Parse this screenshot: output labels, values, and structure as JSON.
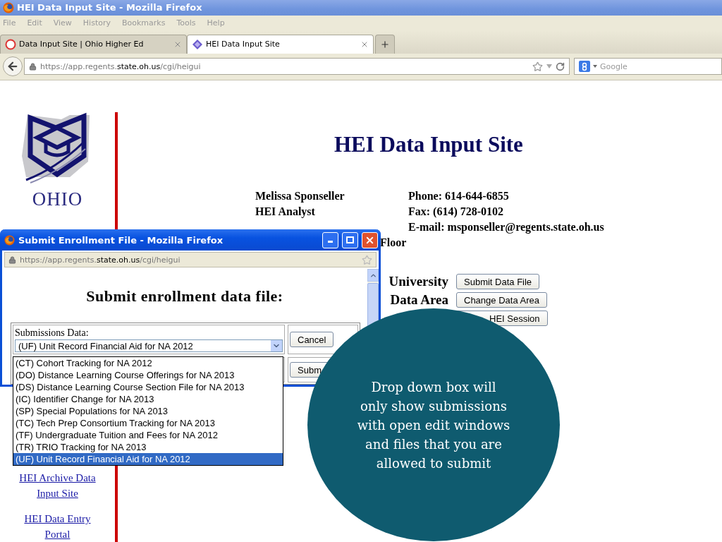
{
  "browser": {
    "title": "HEI Data Input Site - Mozilla Firefox",
    "menu": [
      "File",
      "Edit",
      "View",
      "History",
      "Bookmarks",
      "Tools",
      "Help"
    ],
    "tabs": [
      {
        "label": "Data Input Site | Ohio Higher Ed",
        "selected": false
      },
      {
        "label": "HEI Data Input Site",
        "selected": true
      }
    ],
    "url": "https://app.regents.**state.oh.us**/cgi/heigui",
    "search": {
      "placeholder": "Google"
    }
  },
  "page": {
    "logo_text": "OHIO",
    "links": [
      "HEI Archive Data Input Site",
      "HEI Data Entry Portal"
    ],
    "title": "HEI Data Input Site",
    "contact_left": [
      "Melissa Sponseller",
      "HEI Analyst"
    ],
    "contact_right": [
      "Phone: 614-644-6855",
      "Fax: (614) 728-0102",
      "E-mail: msponseller@regents.state.oh.us"
    ],
    "address_end": "Floor",
    "actions": [
      {
        "label": "University",
        "button": "Submit Data File"
      },
      {
        "label": "Data Area",
        "button": "Change Data Area"
      },
      {
        "button": "HEI Session"
      }
    ]
  },
  "popup": {
    "title": "Submit Enrollment File - Mozilla Firefox",
    "url": "https://app.regents.**state.oh.us**/cgi/heigui",
    "heading": "Submit enrollment data file:",
    "field_label": "Submissions Data:",
    "select": {
      "value": "(UF) Unit Record Financial Aid for NA 2012",
      "options": [
        {
          "label": "(CT) Cohort Tracking for NA 2012",
          "selected": false
        },
        {
          "label": "(DO) Distance Learning Course Offerings for NA 2013",
          "selected": false
        },
        {
          "label": "(DS) Distance Learning Course Section File for NA 2013",
          "selected": false
        },
        {
          "label": "(IC) Identifier Change for NA 2013",
          "selected": false
        },
        {
          "label": "(SP) Special Populations for NA 2013",
          "selected": false
        },
        {
          "label": "(TC) Tech Prep Consortium Tracking for NA 2013",
          "selected": false
        },
        {
          "label": "(TF) Undergraduate Tuition and Fees for NA 2012",
          "selected": false
        },
        {
          "label": "(TR) TRIO Tracking for NA 2013",
          "selected": false
        },
        {
          "label": "(UF) Unit Record Financial Aid for NA 2012",
          "selected": true
        }
      ]
    },
    "buttons": [
      "Cancel",
      "Subm"
    ]
  },
  "callout": {
    "text": "Drop down box will only show submissions with open edit windows and files that you are allowed to submit"
  }
}
